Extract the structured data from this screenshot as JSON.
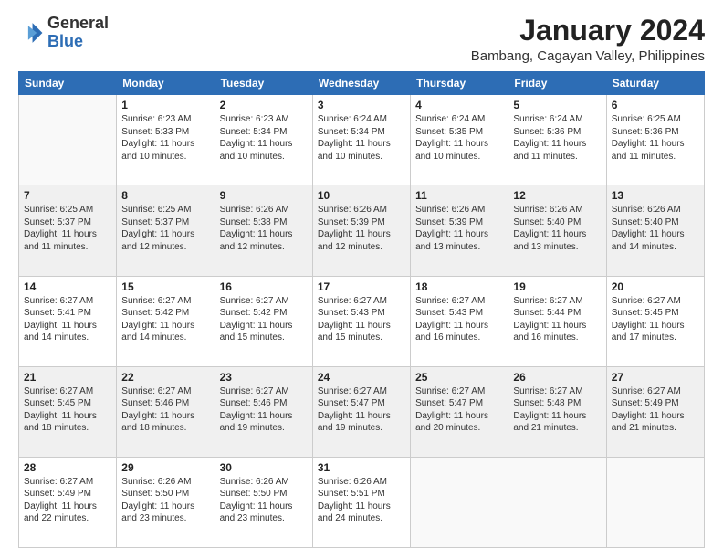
{
  "logo": {
    "general": "General",
    "blue": "Blue"
  },
  "title": "January 2024",
  "location": "Bambang, Cagayan Valley, Philippines",
  "days_header": [
    "Sunday",
    "Monday",
    "Tuesday",
    "Wednesday",
    "Thursday",
    "Friday",
    "Saturday"
  ],
  "weeks": [
    [
      {
        "day": "",
        "info": ""
      },
      {
        "day": "1",
        "info": "Sunrise: 6:23 AM\nSunset: 5:33 PM\nDaylight: 11 hours\nand 10 minutes."
      },
      {
        "day": "2",
        "info": "Sunrise: 6:23 AM\nSunset: 5:34 PM\nDaylight: 11 hours\nand 10 minutes."
      },
      {
        "day": "3",
        "info": "Sunrise: 6:24 AM\nSunset: 5:34 PM\nDaylight: 11 hours\nand 10 minutes."
      },
      {
        "day": "4",
        "info": "Sunrise: 6:24 AM\nSunset: 5:35 PM\nDaylight: 11 hours\nand 10 minutes."
      },
      {
        "day": "5",
        "info": "Sunrise: 6:24 AM\nSunset: 5:36 PM\nDaylight: 11 hours\nand 11 minutes."
      },
      {
        "day": "6",
        "info": "Sunrise: 6:25 AM\nSunset: 5:36 PM\nDaylight: 11 hours\nand 11 minutes."
      }
    ],
    [
      {
        "day": "7",
        "info": "Sunrise: 6:25 AM\nSunset: 5:37 PM\nDaylight: 11 hours\nand 11 minutes."
      },
      {
        "day": "8",
        "info": "Sunrise: 6:25 AM\nSunset: 5:37 PM\nDaylight: 11 hours\nand 12 minutes."
      },
      {
        "day": "9",
        "info": "Sunrise: 6:26 AM\nSunset: 5:38 PM\nDaylight: 11 hours\nand 12 minutes."
      },
      {
        "day": "10",
        "info": "Sunrise: 6:26 AM\nSunset: 5:39 PM\nDaylight: 11 hours\nand 12 minutes."
      },
      {
        "day": "11",
        "info": "Sunrise: 6:26 AM\nSunset: 5:39 PM\nDaylight: 11 hours\nand 13 minutes."
      },
      {
        "day": "12",
        "info": "Sunrise: 6:26 AM\nSunset: 5:40 PM\nDaylight: 11 hours\nand 13 minutes."
      },
      {
        "day": "13",
        "info": "Sunrise: 6:26 AM\nSunset: 5:40 PM\nDaylight: 11 hours\nand 14 minutes."
      }
    ],
    [
      {
        "day": "14",
        "info": "Sunrise: 6:27 AM\nSunset: 5:41 PM\nDaylight: 11 hours\nand 14 minutes."
      },
      {
        "day": "15",
        "info": "Sunrise: 6:27 AM\nSunset: 5:42 PM\nDaylight: 11 hours\nand 14 minutes."
      },
      {
        "day": "16",
        "info": "Sunrise: 6:27 AM\nSunset: 5:42 PM\nDaylight: 11 hours\nand 15 minutes."
      },
      {
        "day": "17",
        "info": "Sunrise: 6:27 AM\nSunset: 5:43 PM\nDaylight: 11 hours\nand 15 minutes."
      },
      {
        "day": "18",
        "info": "Sunrise: 6:27 AM\nSunset: 5:43 PM\nDaylight: 11 hours\nand 16 minutes."
      },
      {
        "day": "19",
        "info": "Sunrise: 6:27 AM\nSunset: 5:44 PM\nDaylight: 11 hours\nand 16 minutes."
      },
      {
        "day": "20",
        "info": "Sunrise: 6:27 AM\nSunset: 5:45 PM\nDaylight: 11 hours\nand 17 minutes."
      }
    ],
    [
      {
        "day": "21",
        "info": "Sunrise: 6:27 AM\nSunset: 5:45 PM\nDaylight: 11 hours\nand 18 minutes."
      },
      {
        "day": "22",
        "info": "Sunrise: 6:27 AM\nSunset: 5:46 PM\nDaylight: 11 hours\nand 18 minutes."
      },
      {
        "day": "23",
        "info": "Sunrise: 6:27 AM\nSunset: 5:46 PM\nDaylight: 11 hours\nand 19 minutes."
      },
      {
        "day": "24",
        "info": "Sunrise: 6:27 AM\nSunset: 5:47 PM\nDaylight: 11 hours\nand 19 minutes."
      },
      {
        "day": "25",
        "info": "Sunrise: 6:27 AM\nSunset: 5:47 PM\nDaylight: 11 hours\nand 20 minutes."
      },
      {
        "day": "26",
        "info": "Sunrise: 6:27 AM\nSunset: 5:48 PM\nDaylight: 11 hours\nand 21 minutes."
      },
      {
        "day": "27",
        "info": "Sunrise: 6:27 AM\nSunset: 5:49 PM\nDaylight: 11 hours\nand 21 minutes."
      }
    ],
    [
      {
        "day": "28",
        "info": "Sunrise: 6:27 AM\nSunset: 5:49 PM\nDaylight: 11 hours\nand 22 minutes."
      },
      {
        "day": "29",
        "info": "Sunrise: 6:26 AM\nSunset: 5:50 PM\nDaylight: 11 hours\nand 23 minutes."
      },
      {
        "day": "30",
        "info": "Sunrise: 6:26 AM\nSunset: 5:50 PM\nDaylight: 11 hours\nand 23 minutes."
      },
      {
        "day": "31",
        "info": "Sunrise: 6:26 AM\nSunset: 5:51 PM\nDaylight: 11 hours\nand 24 minutes."
      },
      {
        "day": "",
        "info": ""
      },
      {
        "day": "",
        "info": ""
      },
      {
        "day": "",
        "info": ""
      }
    ]
  ]
}
